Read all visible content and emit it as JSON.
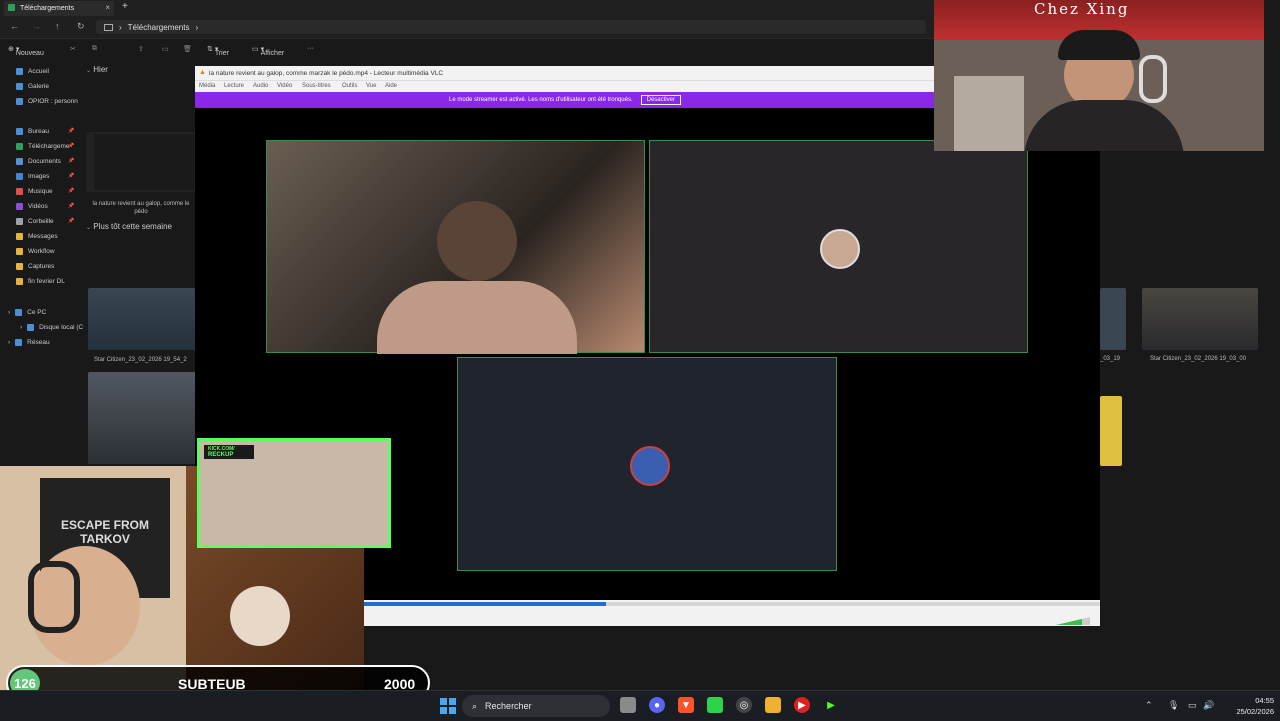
{
  "explorer": {
    "tab_title": "Téléchargements",
    "tab_close": "×",
    "new_tab": "+",
    "breadcrumb": "Téléchargements",
    "toolbar": {
      "new_label": "Nouveau",
      "sort_label": "Trier",
      "view_label": "Afficher",
      "more": "···"
    },
    "sidebar": [
      {
        "label": "Accueil",
        "color": "#4c8fd6"
      },
      {
        "label": "Galerie",
        "color": "#4c8fd6"
      },
      {
        "label": "OPIOR : personn",
        "color": "#4c8fd6"
      },
      {
        "label": "Bureau",
        "color": "#4c8fd6"
      },
      {
        "label": "Téléchargeme",
        "color": "#2da05a"
      },
      {
        "label": "Documents",
        "color": "#5a8fd6"
      },
      {
        "label": "Images",
        "color": "#3f87d6"
      },
      {
        "label": "Musique",
        "color": "#e04f4f"
      },
      {
        "label": "Vidéos",
        "color": "#8a4fd6"
      },
      {
        "label": "Corbeille",
        "color": "#9aa3ad"
      },
      {
        "label": "Messages",
        "color": "#e6b43c"
      },
      {
        "label": "Workflow",
        "color": "#e6b43c"
      },
      {
        "label": "Captures",
        "color": "#e6b43c"
      },
      {
        "label": "fin fevrier DL",
        "color": "#e6b43c"
      }
    ],
    "tree": [
      {
        "label": "Ce PC"
      },
      {
        "label": "Disque local (C"
      },
      {
        "label": "Réseau"
      }
    ],
    "group_yesterday": "Hier",
    "group_earlier": "Plus tôt cette semaine",
    "file_yesterday_caption": "la nature revient au galop, comme le pédo",
    "file_sc1_caption": "Star Citizen_23_02_2026 19_54_2",
    "file_right_caption": "Star Citizen_23_02_2026 19_03_00",
    "file_right_partial": "_03_19"
  },
  "vlc": {
    "title": "la nature revient au galop, comme marzak le pédo.mp4 - Lecteur multimédia VLC",
    "menu": [
      "Média",
      "Lecture",
      "Audio",
      "Vidéo",
      "Sous-titres",
      "Outils",
      "Vue",
      "Aide"
    ],
    "streamer_notice": "Le mode streamer est activé. Les noms d'utilisateur ont été tronqués.",
    "streamer_button": "Désactiver",
    "progress": 0.33
  },
  "overlay": {
    "sub_count": "126",
    "sub_name": "SUBTEUB",
    "sub_goal": "2000",
    "kick_line1": "KICK.COM/",
    "kick_line2": "RECKUP",
    "banner_text": "Chez Xing",
    "poster_text": "ESCAPE FROM TARKOV"
  },
  "taskbar": {
    "search_placeholder": "Rechercher",
    "time": "04:55",
    "date": "25/02/2026"
  },
  "colors": {
    "accent_purple": "#8a27e8",
    "tile_border": "#3b8a4e",
    "kick_green": "#5bff5b",
    "vlc_progress": "#1e6fd0"
  }
}
